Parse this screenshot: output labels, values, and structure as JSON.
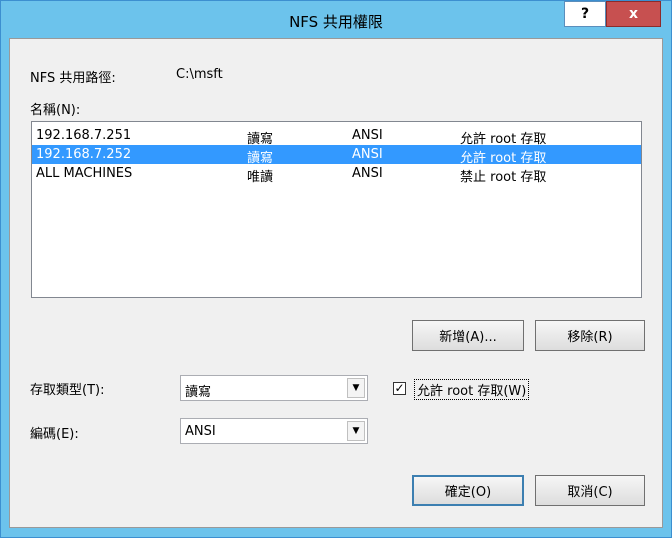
{
  "window": {
    "title": "NFS 共用權限",
    "help_label": "?",
    "close_label": "x"
  },
  "share_path": {
    "label": "NFS 共用路徑:",
    "value": "C:\\msft"
  },
  "names": {
    "label": "名稱(N):",
    "rows": [
      {
        "host": "192.168.7.251",
        "access": "讀寫",
        "encoding": "ANSI",
        "root": "允許 root 存取",
        "selected": false
      },
      {
        "host": "192.168.7.252",
        "access": "讀寫",
        "encoding": "ANSI",
        "root": "允許 root 存取",
        "selected": true
      },
      {
        "host": "ALL MACHINES",
        "access": "唯讀",
        "encoding": "ANSI",
        "root": "禁止 root 存取",
        "selected": false
      }
    ]
  },
  "buttons": {
    "add": "新增(A)...",
    "remove": "移除(R)",
    "ok": "確定(O)",
    "cancel": "取消(C)"
  },
  "access_type": {
    "label": "存取類型(T):",
    "value": "讀寫"
  },
  "encoding": {
    "label": "編碼(E):",
    "value": "ANSI"
  },
  "allow_root": {
    "label": "允許 root 存取(W)",
    "checked": true,
    "check_glyph": "✓"
  },
  "colors": {
    "titlebar": "#6cc3ec",
    "selection": "#3399ff",
    "close_button": "#c75050"
  }
}
